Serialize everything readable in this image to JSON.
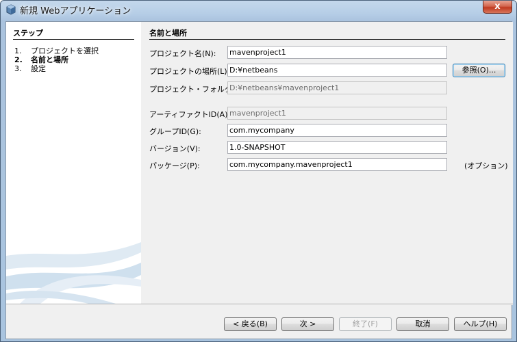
{
  "window": {
    "title": "新規 Webアプリケーション",
    "close_label": "x"
  },
  "steps": {
    "heading": "ステップ",
    "items": [
      {
        "num": "1.",
        "label": "プロジェクトを選択"
      },
      {
        "num": "2.",
        "label": "名前と場所"
      },
      {
        "num": "3.",
        "label": "設定"
      }
    ]
  },
  "panel": {
    "heading": "名前と場所",
    "fields": {
      "project_name": {
        "label": "プロジェクト名(N):",
        "value": "mavenproject1"
      },
      "project_location": {
        "label": "プロジェクトの場所(L):",
        "value": "D:¥netbeans"
      },
      "project_folder": {
        "label": "プロジェクト・フォルダ(D):",
        "value": "D:¥netbeans¥mavenproject1"
      },
      "artifact_id": {
        "label": "アーティファクトID(A):",
        "value": "mavenproject1"
      },
      "group_id": {
        "label": "グループID(G):",
        "value": "com.mycompany"
      },
      "version": {
        "label": "バージョン(V):",
        "value": "1.0-SNAPSHOT"
      },
      "package": {
        "label": "パッケージ(P):",
        "value": "com.mycompany.mavenproject1"
      }
    },
    "browse_label": "参照(O)...",
    "optional_note": "(オプション)"
  },
  "footer": {
    "back": "< 戻る(B)",
    "next": "次 >",
    "finish": "終了(F)",
    "cancel": "取消",
    "help": "ヘルプ(H)"
  }
}
